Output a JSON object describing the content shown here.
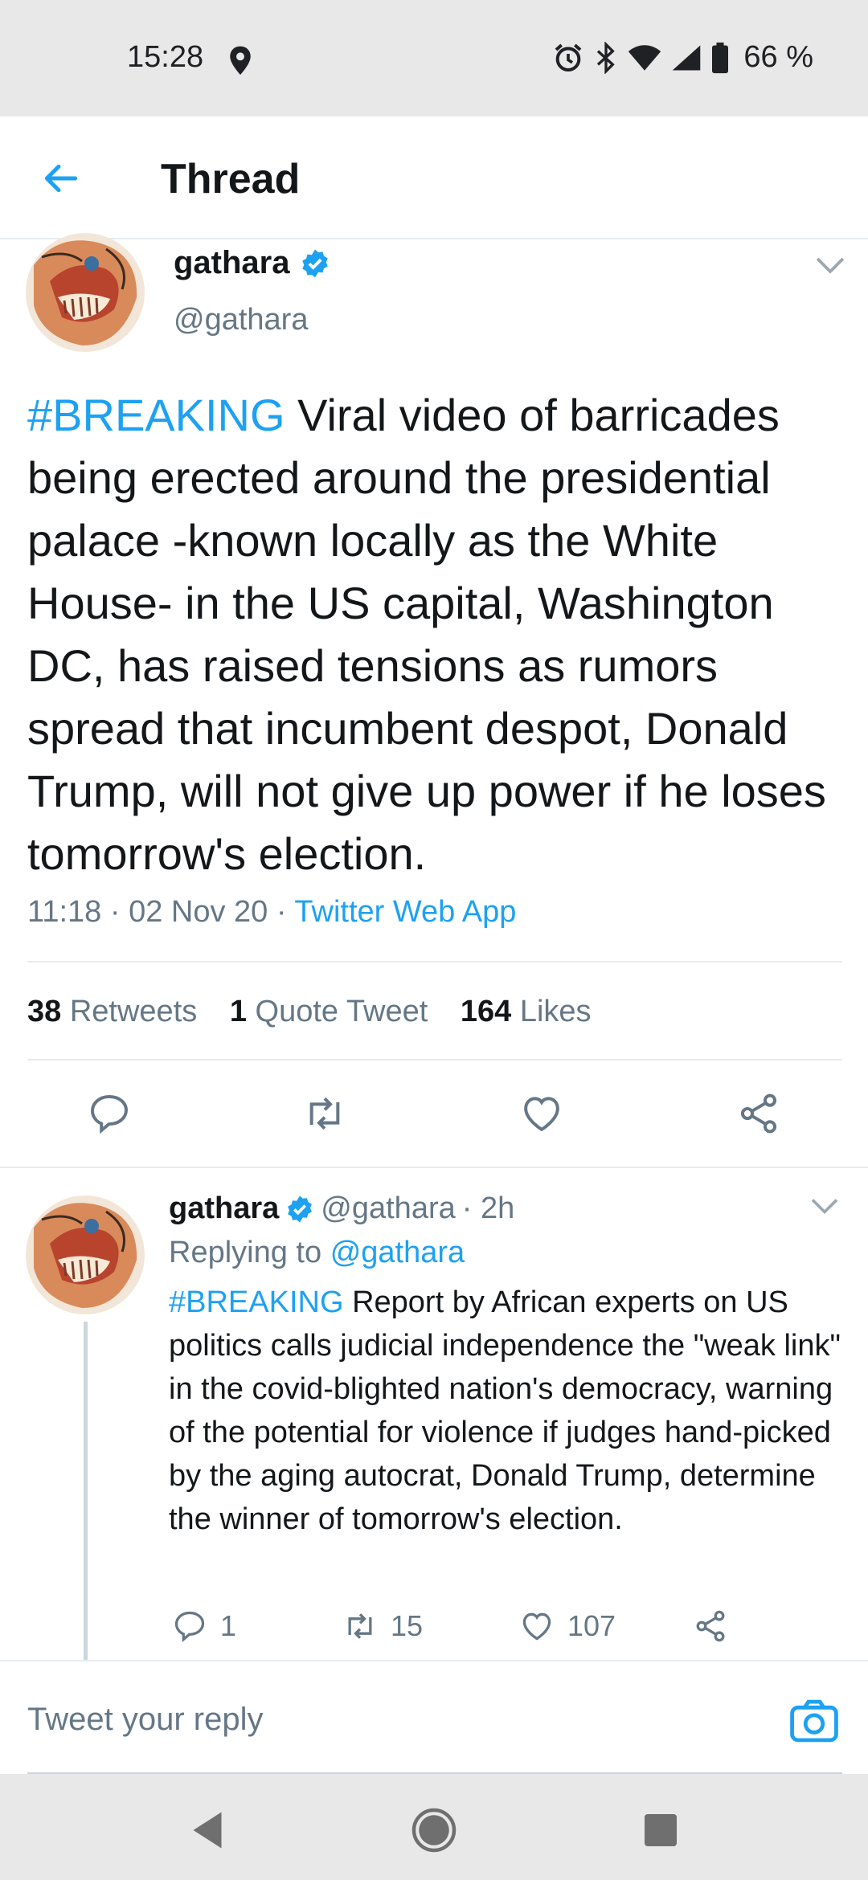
{
  "status_bar": {
    "time": "15:28",
    "battery": "66 %",
    "icons": [
      "location-icon",
      "alarm-icon",
      "bluetooth-icon",
      "wifi-icon",
      "signal-icon",
      "battery-icon"
    ]
  },
  "header": {
    "title": "Thread",
    "back_icon": "arrow-left-icon"
  },
  "main_tweet": {
    "name": "gathara",
    "handle": "@gathara",
    "verified": true,
    "hashtag": "#BREAKING",
    "text": " Viral video of barricades being erected around the presidential palace -known locally as the White House- in the US capital, Washington DC, has raised tensions as rumors spread that incumbent despot, Donald Trump, will not give up power if he loses tomorrow's election.",
    "time": "11:18",
    "date": "02 Nov 20",
    "source": "Twitter Web App",
    "stats": {
      "retweets_count": "38",
      "retweets_label": "Retweets",
      "quotes_count": "1",
      "quotes_label": "Quote Tweet",
      "likes_count": "164",
      "likes_label": "Likes"
    }
  },
  "reply_tweet": {
    "name": "gathara",
    "handle": "@gathara",
    "age": "· 2h",
    "replying_label": "Replying to",
    "replying_to": "@gathara",
    "hashtag": "#BREAKING",
    "text": " Report by African experts on US politics calls judicial independence the \"weak link\" in the covid-blighted nation's democracy, warning of the potential for violence if judges hand-picked by the aging autocrat, Donald Trump, determine the winner of tomorrow's election.",
    "replies": "1",
    "retweets": "15",
    "likes": "107"
  },
  "reply_box": {
    "placeholder": "Tweet your reply"
  },
  "colors": {
    "accent": "#1da1f2",
    "secondary_text": "#657786",
    "primary_text": "#14171a",
    "divider": "#e6ecf0"
  }
}
